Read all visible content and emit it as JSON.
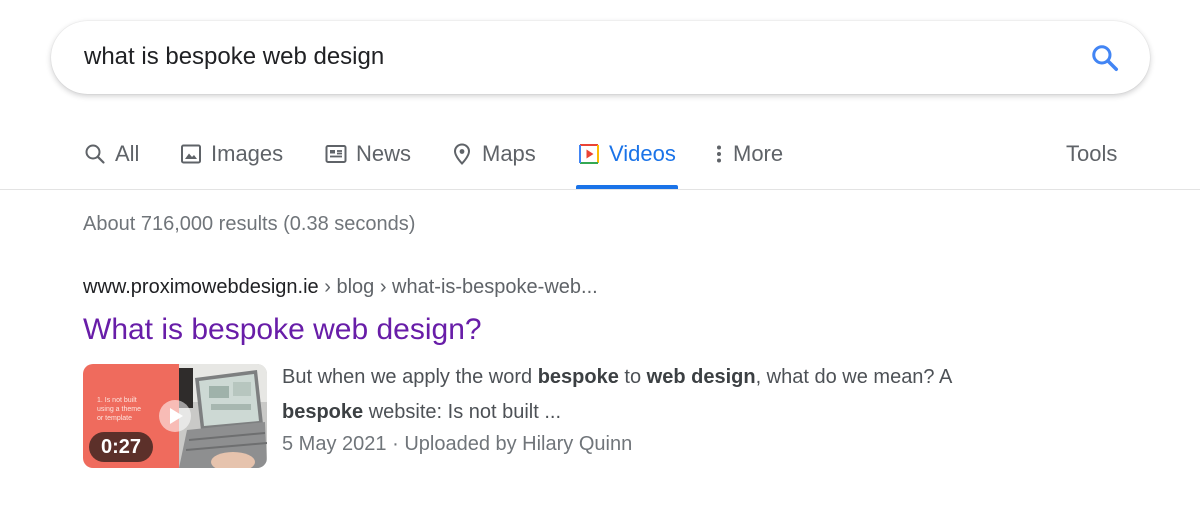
{
  "search": {
    "query": "what is bespoke web design",
    "button_icon": "search-icon",
    "accent_color": "#4285f4"
  },
  "tabs": [
    {
      "label": "All",
      "icon": "search-icon"
    },
    {
      "label": "Images",
      "icon": "image-icon"
    },
    {
      "label": "News",
      "icon": "news-icon"
    },
    {
      "label": "Maps",
      "icon": "map-pin-icon"
    },
    {
      "label": "Videos",
      "icon": "video-icon",
      "active": true
    },
    {
      "label": "More",
      "icon": "more-vertical-icon"
    }
  ],
  "tools_label": "Tools",
  "active_tab_color": "#1a73e8",
  "result_stats": "About 716,000 results (0.38 seconds)",
  "result": {
    "site": "www.proximowebdesign.ie",
    "breadcrumb": "› blog › what-is-bespoke-web...",
    "title": "What is bespoke web design?",
    "title_color": "#681da8",
    "snippet": {
      "t1": "But when we apply the word ",
      "b1": "bespoke",
      "t2": " to ",
      "b2": "web design",
      "t3": ", what do we mean? A ",
      "b3": "bespoke",
      "t4": " website: Is not built ..."
    },
    "date": "5 May 2021",
    "separator": "·",
    "uploader": "Uploaded by Hilary Quinn",
    "thumbnail": {
      "duration": "0:27",
      "overlay_text": [
        "1. Is not built",
        "using a theme",
        "or template"
      ],
      "play_icon": "play-icon"
    }
  }
}
